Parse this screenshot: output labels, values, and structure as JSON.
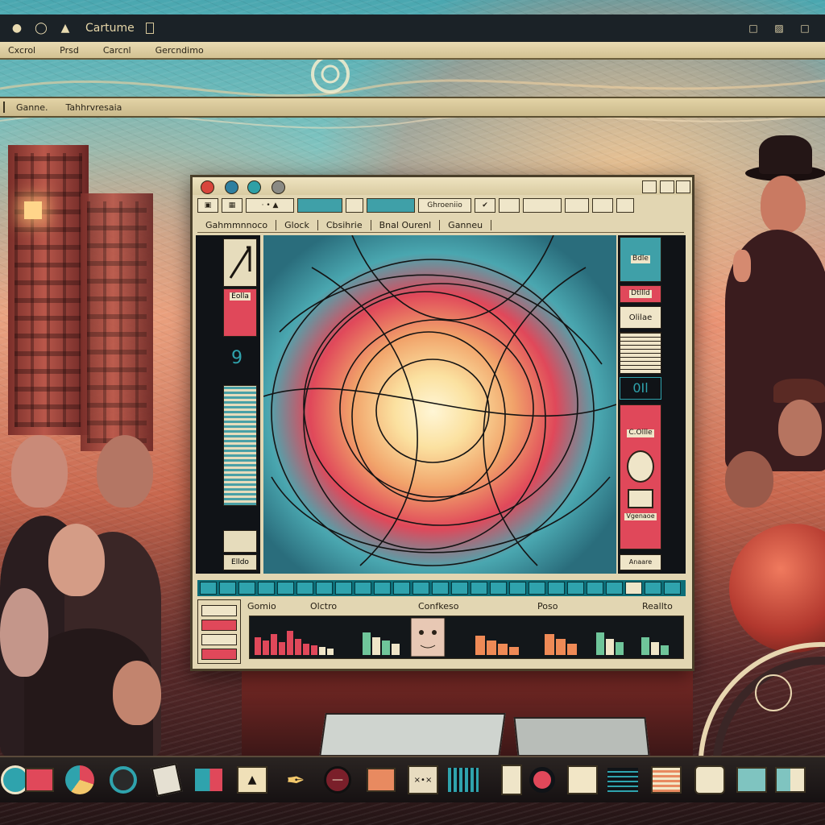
{
  "top_bar": {
    "title": "Cartume"
  },
  "outer_menu": {
    "items": [
      "Cxcrol",
      "Prsd",
      "Carcnl",
      "Gercndimo"
    ]
  },
  "second_bar": {
    "items": [
      "Ganne.",
      "Tahhrvresaia"
    ]
  },
  "main_window": {
    "toolbar": {
      "tools": [
        "",
        "",
        "",
        "",
        "",
        "",
        "",
        "",
        "Ghroeniio",
        "",
        "",
        "",
        "",
        ""
      ]
    },
    "tabs": [
      "Gahmmnnoco",
      "Glock",
      "Cbsihrie",
      "Bnal Ourenl",
      "Ganneu"
    ],
    "left_panel": {
      "digit": "9",
      "label_top": "Eolla",
      "label_bottom": "Elldo"
    },
    "right_panel": {
      "label_1": "Bdle",
      "label_2": "Dtllld",
      "label_3": "Olilae",
      "label_4": "0Il",
      "label_5": "C.Ollle",
      "label_6": "Vgenaoe",
      "label_7": "Anaare"
    },
    "lower_panel": {
      "left_rows": [
        "",
        "",
        "",
        ""
      ],
      "graph_labels": [
        "Gomio",
        "Olctro",
        "Confkeso",
        "Poso",
        "Reallto"
      ]
    }
  },
  "colors": {
    "window": "#e2d6b2",
    "teal": "#3fa0a8",
    "red": "#e0485a",
    "gold": "#f2c76b",
    "dark": "#101317"
  },
  "dock": {
    "icons": [
      "compass-icon",
      "flag-icon",
      "chart-icon",
      "swirl-icon",
      "note-icon",
      "window-icon",
      "mountain-icon",
      "pen-icon",
      "stop-icon",
      "box-icon",
      "xk-icon",
      "film-icon",
      "cup-icon",
      "record-icon",
      "blank-icon",
      "terminal-icon",
      "list-icon",
      "camera-icon",
      "grid-icon",
      "tiles-icon"
    ]
  }
}
